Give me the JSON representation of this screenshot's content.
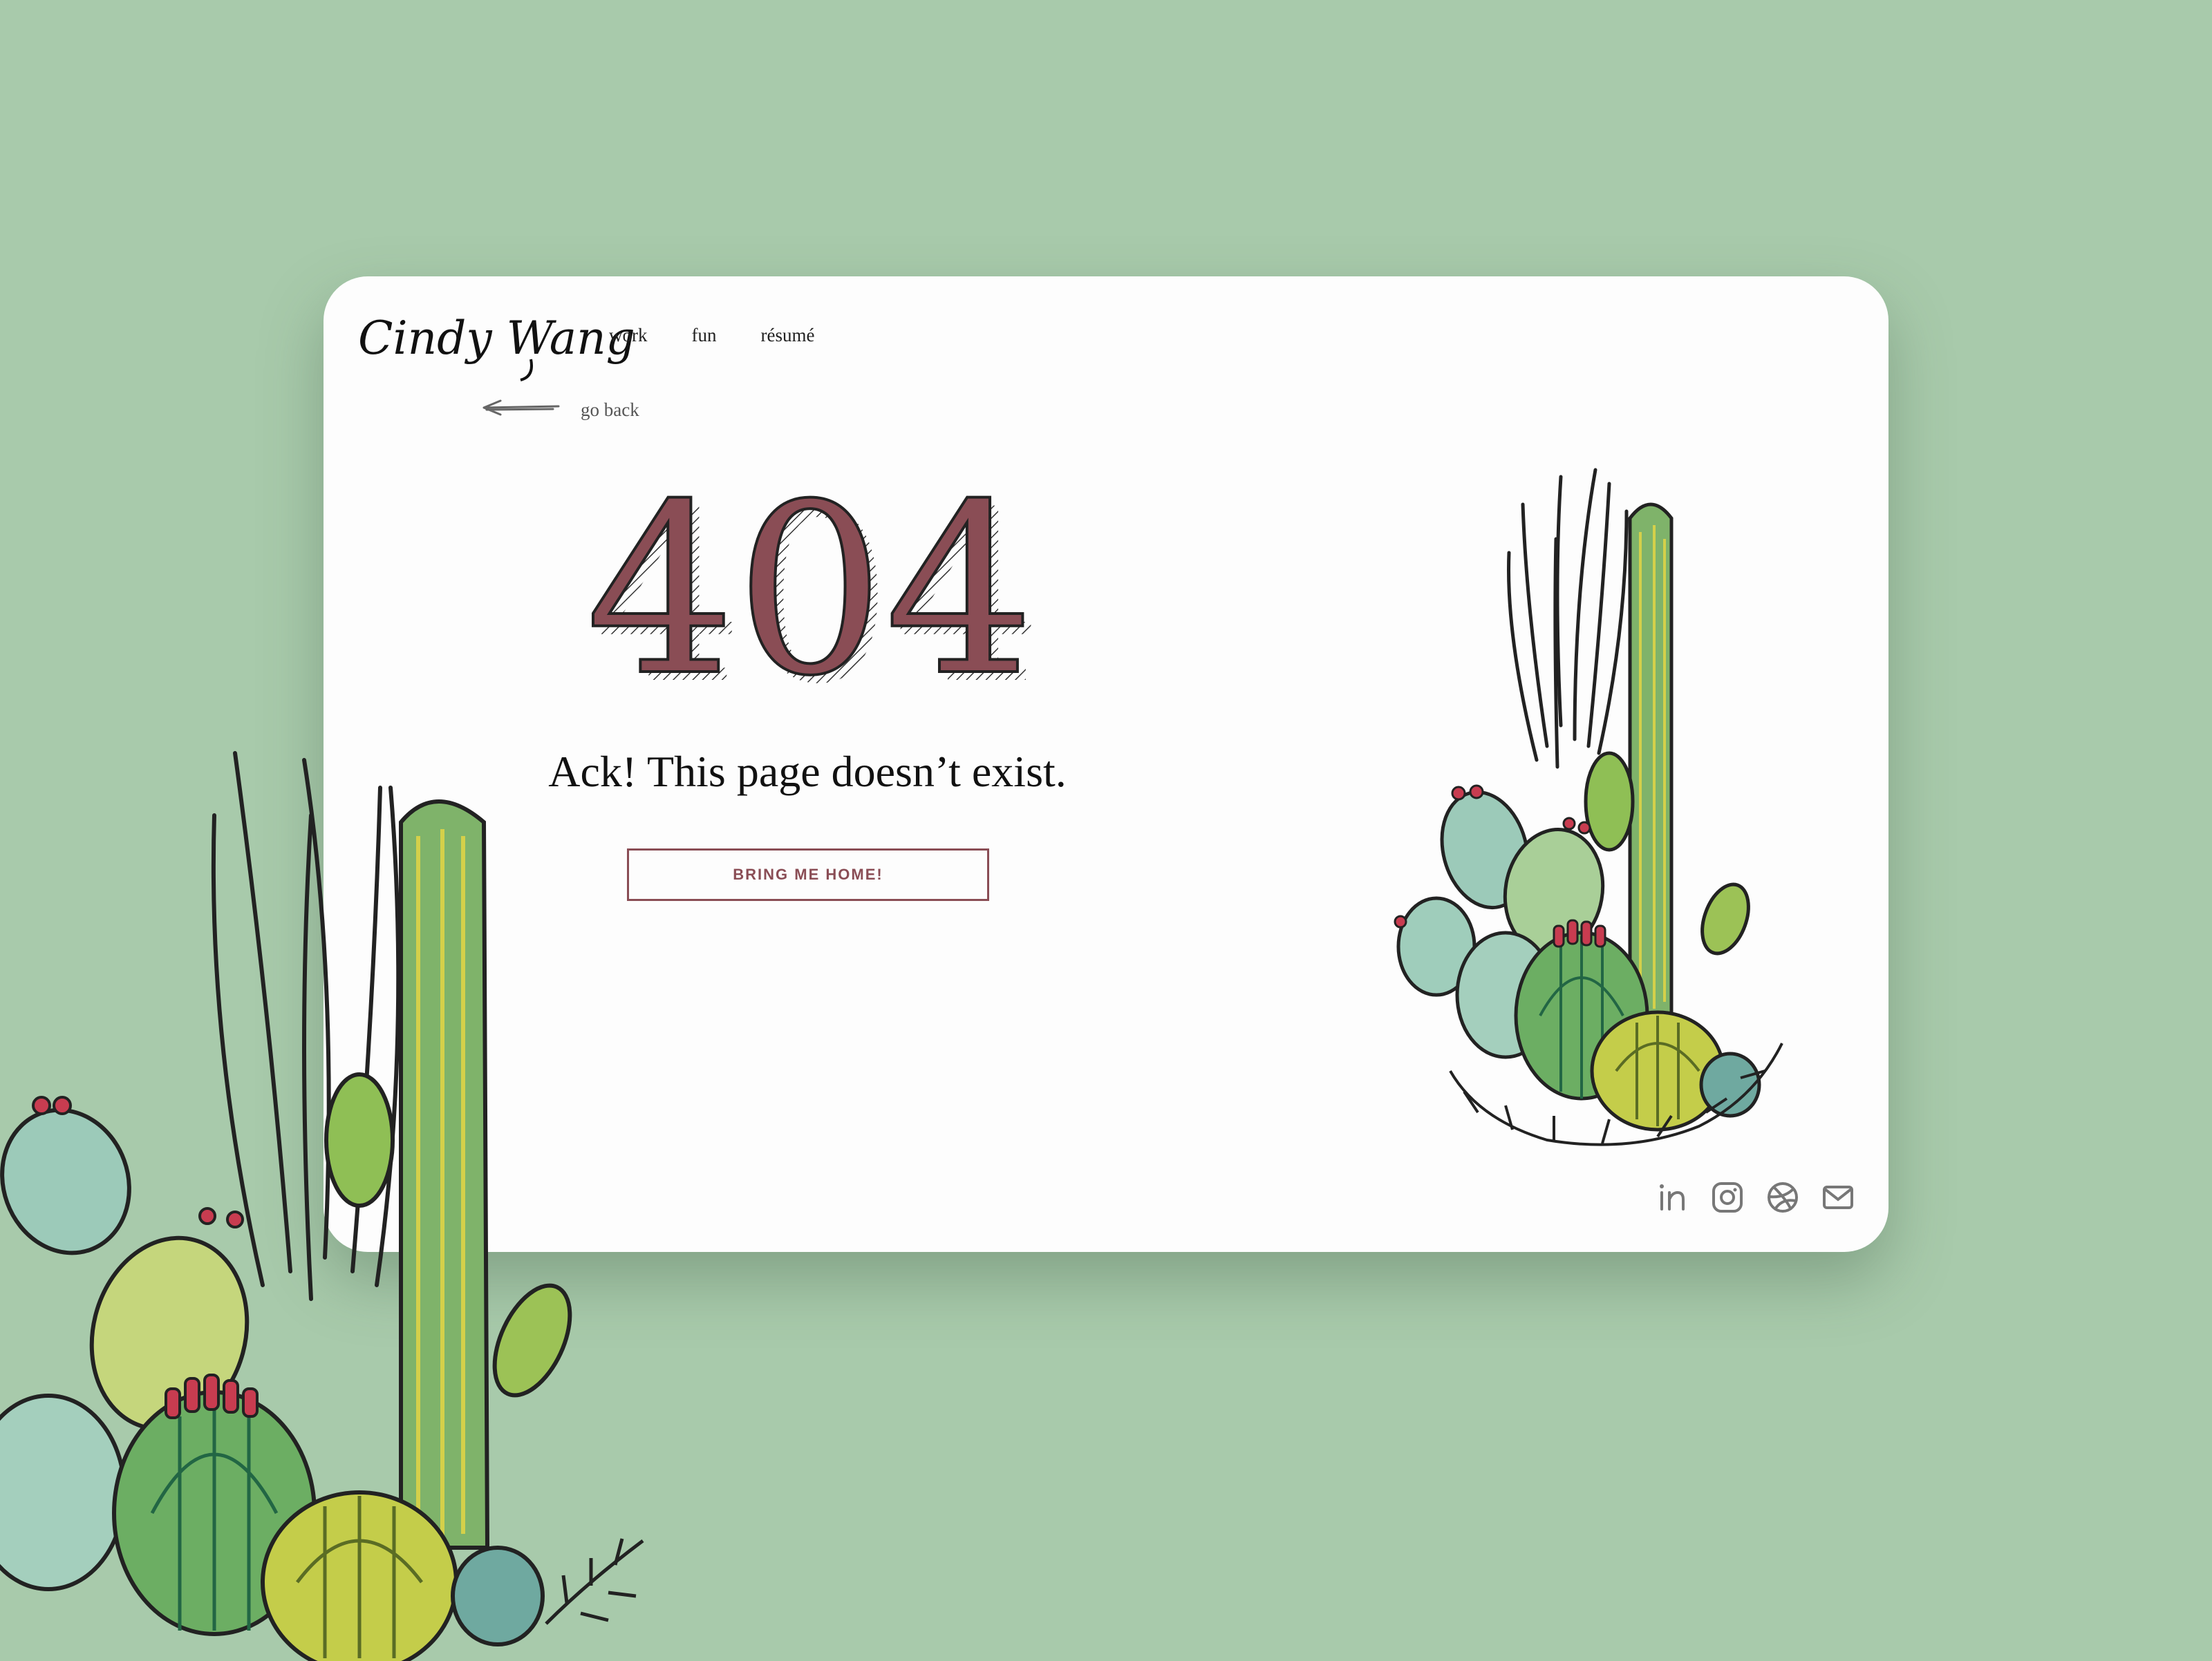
{
  "header": {
    "logo_text": "Cindy Wang",
    "nav": [
      {
        "label": "work"
      },
      {
        "label": "fun"
      },
      {
        "label": "résumé"
      }
    ]
  },
  "back_link": {
    "label": "go back",
    "icon": "arrow-left-icon"
  },
  "error": {
    "code": "404",
    "message": "Ack! This page doesn’t exist.",
    "button_label": "BRING ME HOME!"
  },
  "socials": [
    {
      "name": "linkedin-icon"
    },
    {
      "name": "instagram-icon"
    },
    {
      "name": "dribbble-icon"
    },
    {
      "name": "mail-icon"
    }
  ],
  "colors": {
    "background": "#a8caab",
    "card": "#fdfdfd",
    "accent": "#8a4d55",
    "cactus_green": "#7fb36a",
    "cactus_blue": "#8fc0b8",
    "flower_red": "#c83c50"
  }
}
